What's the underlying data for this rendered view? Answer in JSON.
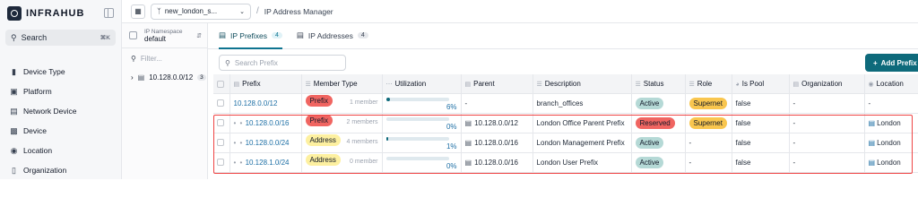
{
  "app": {
    "logo_text": "INFRAHUB"
  },
  "sidebar": {
    "search_label": "Search",
    "search_shortcut": "⌘K",
    "items": [
      {
        "label": "Device Type",
        "icon": "bar-chart-icon"
      },
      {
        "label": "Platform",
        "icon": "platform-icon"
      },
      {
        "label": "Network Device",
        "icon": "network-device-icon"
      },
      {
        "label": "Device",
        "icon": "device-icon"
      },
      {
        "label": "Location",
        "icon": "location-pin-icon"
      },
      {
        "label": "Organization",
        "icon": "organization-icon"
      }
    ]
  },
  "topbar": {
    "branch_name": "new_london_s...",
    "breadcrumb": "IP Address Manager"
  },
  "namespace": {
    "caption": "IP Namespace",
    "value": "default",
    "filter_placeholder": "Filter...",
    "tree": [
      {
        "label": "10.128.0.0/12",
        "count": "3"
      }
    ]
  },
  "tabs": [
    {
      "label": "IP Prefixes",
      "count": "4",
      "active": true
    },
    {
      "label": "IP Addresses",
      "count": "4",
      "active": false
    }
  ],
  "toolbar": {
    "search_placeholder": "Search Prefix",
    "add_label": "Add Prefix"
  },
  "table": {
    "columns": [
      "Prefix",
      "Member Type",
      "Utilization",
      "Parent",
      "Description",
      "Status",
      "Role",
      "Is Pool",
      "Organization",
      "Location"
    ],
    "rows": [
      {
        "prefix": "10.128.0.0/12",
        "indent": "",
        "member_type": "Prefix",
        "members": "1 member",
        "utilization": "6%",
        "util_fraction": 0.06,
        "parent": "-",
        "description": "branch_offices",
        "status": "Active",
        "role": "Supernet",
        "is_pool": "false",
        "organization": "-",
        "location": "-"
      },
      {
        "prefix": "10.128.0.0/16",
        "indent": "• •",
        "member_type": "Prefix",
        "members": "2 members",
        "utilization": "0%",
        "util_fraction": 0.0,
        "parent": "10.128.0.0/12",
        "description": "London Office Parent Prefix",
        "status": "Reserved",
        "role": "Supernet",
        "is_pool": "false",
        "organization": "-",
        "location": "London"
      },
      {
        "prefix": "10.128.0.0/24",
        "indent": "• •",
        "member_type": "Address",
        "members": "4 members",
        "utilization": "1%",
        "util_fraction": 0.01,
        "parent": "10.128.0.0/16",
        "description": "London Management Prefix",
        "status": "Active",
        "role": "-",
        "is_pool": "false",
        "organization": "-",
        "location": "London"
      },
      {
        "prefix": "10.128.1.0/24",
        "indent": "• •",
        "member_type": "Address",
        "members": "0 member",
        "utilization": "0%",
        "util_fraction": 0.0,
        "parent": "10.128.0.0/16",
        "description": "London User Prefix",
        "status": "Active",
        "role": "-",
        "is_pool": "false",
        "organization": "-",
        "location": "London"
      }
    ]
  },
  "colors": {
    "accent": "#0e6a7b",
    "prefix_pill": "#f06561",
    "address_pill": "#fdf0a0",
    "active_pill": "#b5d9d6",
    "reserved_pill": "#f06561",
    "supernet_pill": "#f9c64f",
    "highlight_border": "#ef4444"
  }
}
